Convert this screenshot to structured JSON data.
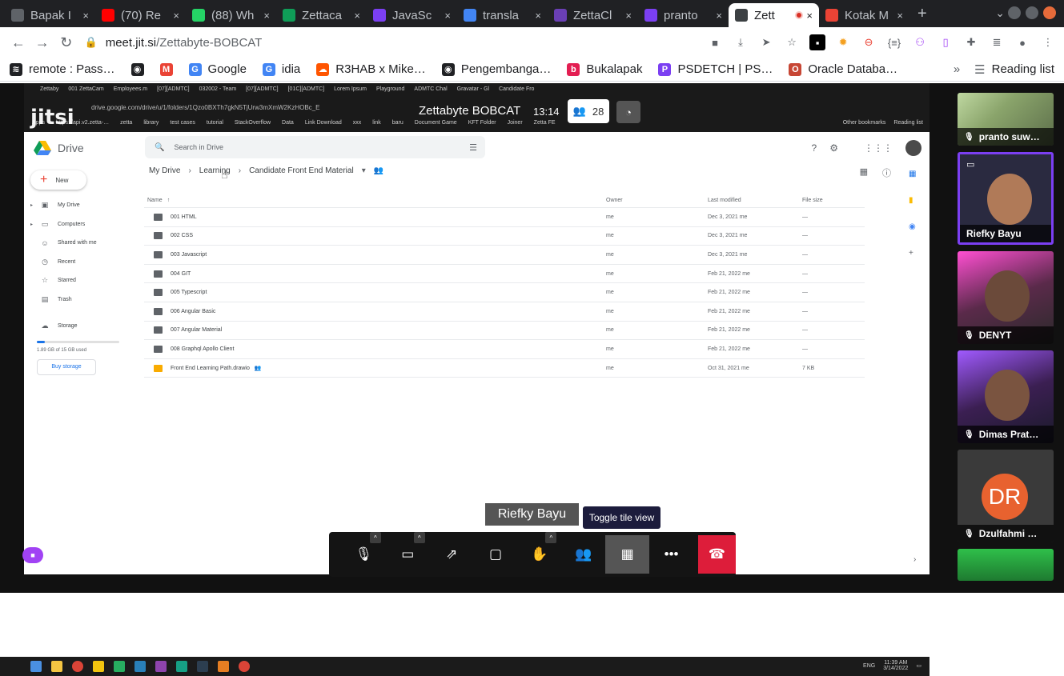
{
  "browser": {
    "tabs": [
      {
        "label": "Bapak I",
        "icon_color": "#5f6368",
        "active": false
      },
      {
        "label": "(70) Re",
        "icon_color": "#ff0000",
        "active": false
      },
      {
        "label": "(88) Wh",
        "icon_color": "#25d366",
        "active": false
      },
      {
        "label": "Zettaca",
        "icon_color": "#0f9d58",
        "active": false
      },
      {
        "label": "JavaSc",
        "icon_color": "#7b3ff2",
        "active": false
      },
      {
        "label": "transla",
        "icon_color": "#4285f4",
        "active": false
      },
      {
        "label": "ZettaCl",
        "icon_color": "#6a3fb5",
        "active": false
      },
      {
        "label": "pranto",
        "icon_color": "#7b3ff2",
        "active": false
      },
      {
        "label": "Zett",
        "icon_color": "#3c4043",
        "active": true
      },
      {
        "label": "Kotak M",
        "icon_color": "#ea4335",
        "active": false
      }
    ],
    "new_tab": "+",
    "url_host": "meet.jit.si",
    "url_path": "/Zettabyte-BOBCAT",
    "bookmarks": [
      {
        "label": "remote : Pass…",
        "icon_color": "#202124",
        "icon": "≋"
      },
      {
        "label": "",
        "icon_color": "#202124",
        "icon": "◉"
      },
      {
        "label": "",
        "icon_color": "#ea4335",
        "icon": "M"
      },
      {
        "label": "Google",
        "icon_color": "#4285f4",
        "icon": "G"
      },
      {
        "label": "idia",
        "icon_color": "#4285f4",
        "icon": "G"
      },
      {
        "label": "R3HAB x Mike…",
        "icon_color": "#ff5500",
        "icon": "☁"
      },
      {
        "label": "Pengembanga…",
        "icon_color": "#202124",
        "icon": "◉"
      },
      {
        "label": "Bukalapak",
        "icon_color": "#e31e52",
        "icon": "b"
      },
      {
        "label": "PSDETCH | PS…",
        "icon_color": "#7b3ff2",
        "icon": "P"
      },
      {
        "label": "Oracle Databa…",
        "icon_color": "#c74634",
        "icon": "O"
      }
    ],
    "reading_list": "Reading list"
  },
  "meeting": {
    "title": "Zettabyte BOBCAT",
    "time": "13:14",
    "participants": "28",
    "speaker_label": "Riefky Bayu",
    "tooltip": "Toggle tile view",
    "logo": "jitsi"
  },
  "inner_browser": {
    "tabs": [
      "Zettaby",
      "001 ZettaCam",
      "Employees.m",
      "[07][ADMTC]",
      "032002 - Team",
      "[07][ADMTC]",
      "[01C][ADMTC]",
      "Lorem Ipsum",
      "Playground",
      "ADMTC Chal",
      "Gravatar - Gl",
      "Candidate Fro"
    ],
    "url": "drive.google.com/drive/u/1/folders/1Qzo0BXTh7gkN5TjUrw3mXmW2KzHOBc_E",
    "bookmarks": [
      "Apps",
      "https://api.v2.zetta-…",
      "zetta",
      "library",
      "test cases",
      "tutorial",
      "StackOverflow",
      "Data",
      "Link Download",
      "xxx",
      "link",
      "baru",
      "Document Game",
      "KFT Folder",
      "Joiner",
      "Zetta FE"
    ],
    "bookmarks_right": [
      "Other bookmarks",
      "Reading list"
    ]
  },
  "drive": {
    "logo_text": "Drive",
    "search_placeholder": "Search in Drive",
    "new_label": "New",
    "nav": [
      {
        "label": "My Drive",
        "icon": "▣",
        "caret": "▸"
      },
      {
        "label": "Computers",
        "icon": "▭",
        "caret": "▸"
      },
      {
        "label": "Shared with me",
        "icon": "☺",
        "caret": ""
      },
      {
        "label": "Recent",
        "icon": "◷",
        "caret": ""
      },
      {
        "label": "Starred",
        "icon": "☆",
        "caret": ""
      },
      {
        "label": "Trash",
        "icon": "▤",
        "caret": ""
      }
    ],
    "storage_label": "Storage",
    "storage_used": "1.89 GB of 15 GB used",
    "buy_storage": "Buy storage",
    "breadcrumbs": [
      "My Drive",
      "Learning",
      "Candidate Front End Material"
    ],
    "columns": {
      "name": "Name",
      "owner": "Owner",
      "modified": "Last modified",
      "size": "File size"
    },
    "sort_arrow": "↑",
    "files": [
      {
        "name": "001 HTML",
        "owner": "me",
        "modified": "Dec 3, 2021 me",
        "size": "—",
        "type": "folder"
      },
      {
        "name": "002 CSS",
        "owner": "me",
        "modified": "Dec 3, 2021 me",
        "size": "—",
        "type": "folder"
      },
      {
        "name": "003 Javascript",
        "owner": "me",
        "modified": "Dec 3, 2021 me",
        "size": "—",
        "type": "folder"
      },
      {
        "name": "004 GIT",
        "owner": "me",
        "modified": "Feb 21, 2022 me",
        "size": "—",
        "type": "folder"
      },
      {
        "name": "005 Typescript",
        "owner": "me",
        "modified": "Feb 21, 2022 me",
        "size": "—",
        "type": "folder"
      },
      {
        "name": "006 Angular Basic",
        "owner": "me",
        "modified": "Feb 21, 2022 me",
        "size": "—",
        "type": "folder"
      },
      {
        "name": "007 Angular Material",
        "owner": "me",
        "modified": "Feb 21, 2022 me",
        "size": "—",
        "type": "folder"
      },
      {
        "name": "008 Graphql Apollo Client",
        "owner": "me",
        "modified": "Feb 21, 2022 me",
        "size": "—",
        "type": "folder"
      },
      {
        "name": "Front End Learning Path.drawio",
        "owner": "me",
        "modified": "Oct 31, 2021 me",
        "size": "7 KB",
        "type": "drawio"
      }
    ]
  },
  "participants": [
    {
      "name": "pranto suw…",
      "muted": true
    },
    {
      "name": "Riefky Bayu",
      "muted": false,
      "speaking": true
    },
    {
      "name": "DENYT",
      "muted": true
    },
    {
      "name": "Dimas Prat…",
      "muted": true
    },
    {
      "name": "Dzulfahmi …",
      "muted": true,
      "initials": "DR"
    }
  ],
  "taskbar": {
    "lang": "ENG",
    "clock_time": "11:39 AM",
    "clock_date": "3/14/2022"
  }
}
